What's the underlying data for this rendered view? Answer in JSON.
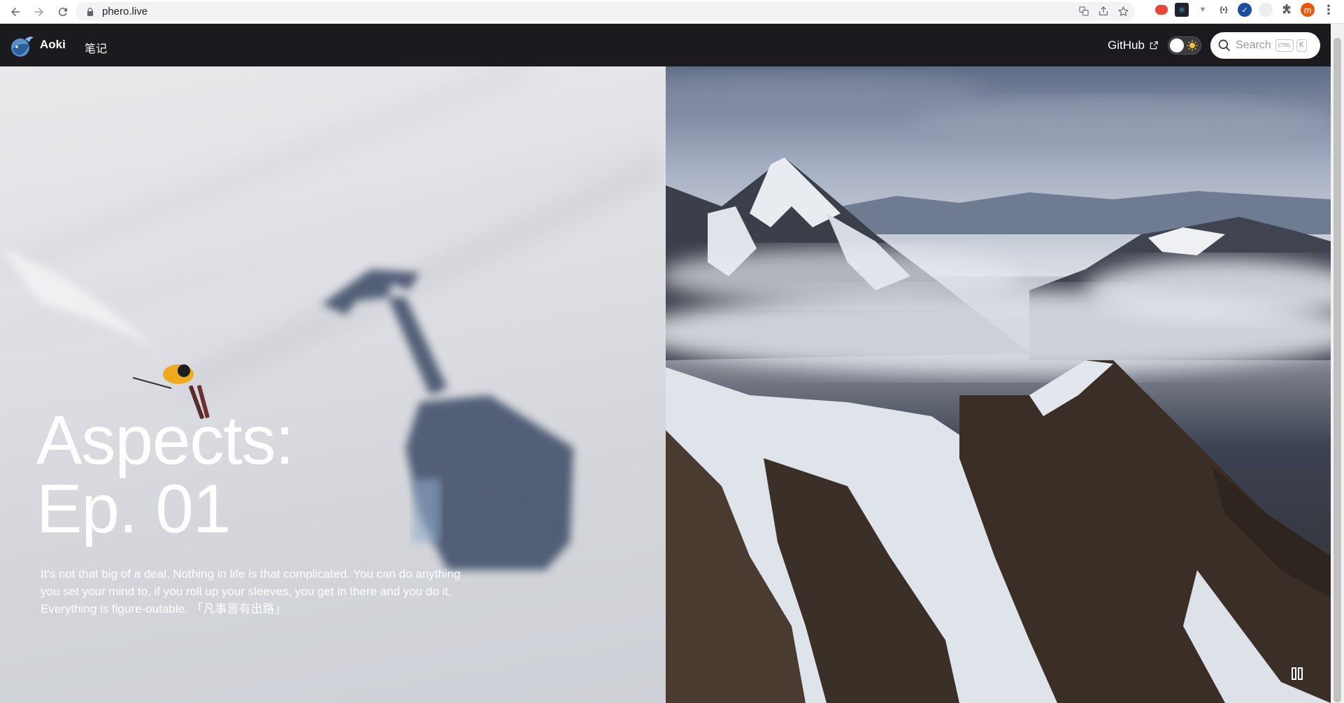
{
  "browser": {
    "url": "phero.live"
  },
  "nav": {
    "brand": "Aoki",
    "link_notes": "笔记",
    "github_label": "GitHub",
    "search_placeholder": "Search",
    "shortcut_ctrl": "CTRL",
    "shortcut_key": "K"
  },
  "hero": {
    "title_line1": "Aspects:",
    "title_line2": "Ep. 01",
    "quote_line1": "It's not that big of a deal. Nothing in life is that complicated. You can do anything",
    "quote_line2": "you set your mind to, if you roll up your sleeves, you get in there and you do it.",
    "quote_line3": "Everything is figure-outable. 「凡事皆有出路」"
  },
  "colors": {
    "nav_bg": "#1b1b1f",
    "accent_toggle": "#f2c12e"
  },
  "icons": [
    "back-arrow-icon",
    "forward-arrow-icon",
    "reload-icon",
    "lock-icon",
    "translate-icon",
    "share-icon",
    "star-icon",
    "extensions-icon",
    "profile-avatar-icon",
    "menu-kebab-icon",
    "logo-icon",
    "external-link-icon",
    "theme-toggle-icon",
    "search-icon",
    "pause-icon"
  ]
}
